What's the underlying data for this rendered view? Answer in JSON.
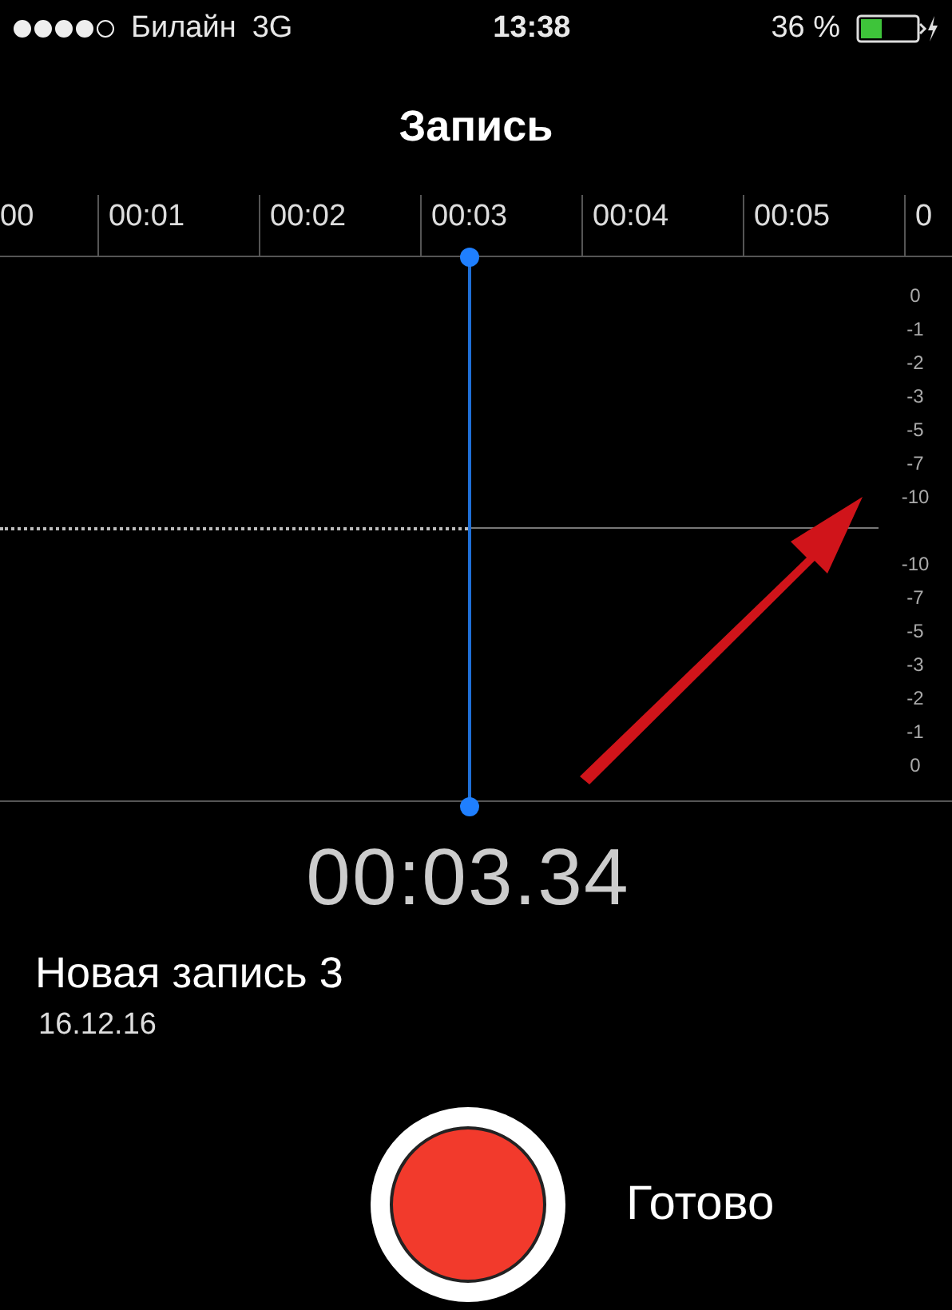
{
  "status_bar": {
    "carrier": "Билайн",
    "network": "3G",
    "time": "13:38",
    "battery": "36 %"
  },
  "title": "Запись",
  "ruler": {
    "labels": [
      "00",
      "00:01",
      "00:02",
      "00:03",
      "00:04",
      "00:05",
      "0"
    ]
  },
  "level_scale": {
    "upper": [
      "0",
      "-1",
      "-2",
      "-3",
      "-5",
      "-7",
      "-10"
    ],
    "lower": [
      "-10",
      "-7",
      "-5",
      "-3",
      "-2",
      "-1",
      "0"
    ]
  },
  "recording": {
    "timer": "00:03.34",
    "name": "Новая запись 3",
    "date": "16.12.16"
  },
  "done_button": "Готово"
}
